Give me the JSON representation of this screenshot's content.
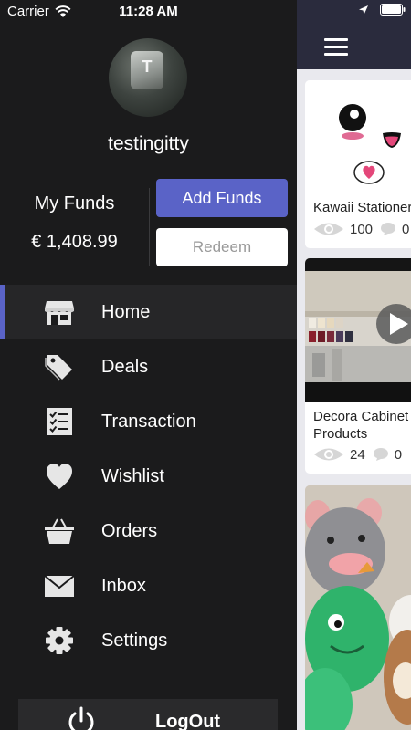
{
  "status_bar": {
    "carrier": "Carrier",
    "time": "11:28 AM"
  },
  "profile": {
    "avatar_letter": "T",
    "username": "testingitty"
  },
  "funds": {
    "label": "My Funds",
    "amount": "€ 1,408.99",
    "add_label": "Add Funds",
    "redeem_label": "Redeem"
  },
  "menu": {
    "items": [
      {
        "label": "Home",
        "icon": "store-icon"
      },
      {
        "label": "Deals",
        "icon": "tag-icon"
      },
      {
        "label": "Transaction",
        "icon": "checklist-icon"
      },
      {
        "label": "Wishlist",
        "icon": "heart-icon"
      },
      {
        "label": "Orders",
        "icon": "basket-icon"
      },
      {
        "label": "Inbox",
        "icon": "envelope-icon"
      },
      {
        "label": "Settings",
        "icon": "gear-icon"
      }
    ],
    "active_index": 0
  },
  "logout": {
    "label": "LogOut"
  },
  "colors": {
    "accent": "#5a63c7",
    "drawer_bg": "#1b1b1c",
    "header_bg": "#2a2b3d"
  },
  "cards": [
    {
      "title": "Kawaii Stationery",
      "views": "100",
      "comments": "0"
    },
    {
      "title": "Decora Cabinet Products",
      "title_line1": "Decora Cabinet",
      "title_line2": "Products",
      "views": "24",
      "comments": "0"
    },
    {
      "title": ""
    }
  ]
}
